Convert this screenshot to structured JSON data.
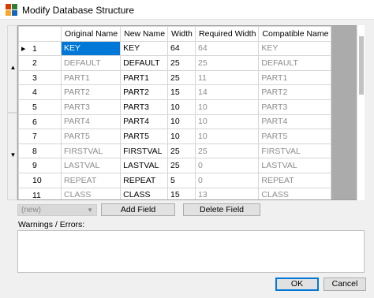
{
  "window": {
    "title": "Modify Database Structure"
  },
  "grid": {
    "columns": [
      "Original Name",
      "New Name",
      "Width",
      "Required Width",
      "Compatible Name"
    ],
    "rows": [
      {
        "num": "1",
        "original": "KEY",
        "new": "KEY",
        "width": "64",
        "required": "64",
        "compatible": "KEY"
      },
      {
        "num": "2",
        "original": "DEFAULT",
        "new": "DEFAULT",
        "width": "25",
        "required": "25",
        "compatible": "DEFAULT"
      },
      {
        "num": "3",
        "original": "PART1",
        "new": "PART1",
        "width": "25",
        "required": "11",
        "compatible": "PART1"
      },
      {
        "num": "4",
        "original": "PART2",
        "new": "PART2",
        "width": "15",
        "required": "14",
        "compatible": "PART2"
      },
      {
        "num": "5",
        "original": "PART3",
        "new": "PART3",
        "width": "10",
        "required": "10",
        "compatible": "PART3"
      },
      {
        "num": "6",
        "original": "PART4",
        "new": "PART4",
        "width": "10",
        "required": "10",
        "compatible": "PART4"
      },
      {
        "num": "7",
        "original": "PART5",
        "new": "PART5",
        "width": "10",
        "required": "10",
        "compatible": "PART5"
      },
      {
        "num": "8",
        "original": "FIRSTVAL",
        "new": "FIRSTVAL",
        "width": "25",
        "required": "25",
        "compatible": "FIRSTVAL"
      },
      {
        "num": "9",
        "original": "LASTVAL",
        "new": "LASTVAL",
        "width": "25",
        "required": "0",
        "compatible": "LASTVAL"
      },
      {
        "num": "10",
        "original": "REPEAT",
        "new": "REPEAT",
        "width": "5",
        "required": "0",
        "compatible": "REPEAT"
      },
      {
        "num": "11",
        "original": "CLASS",
        "new": "CLASS",
        "width": "15",
        "required": "13",
        "compatible": "CLASS"
      }
    ]
  },
  "controls": {
    "combo_value": "(new)",
    "add_field_label": "Add Field",
    "delete_field_label": "Delete Field",
    "warnings_label": "Warnings / Errors:",
    "ok_label": "OK",
    "cancel_label": "Cancel"
  },
  "icons": {
    "app": "app-grid-icon",
    "row_pointer": "row-pointer-icon",
    "scroll_up": "scroll-up-arrow-icon",
    "scroll_down": "scroll-down-arrow-icon",
    "combo_arrow": "chevron-down-icon"
  },
  "colors": {
    "selection": "#0078d7",
    "grid_background": "#ababab",
    "readonly_text": "#8c8c8c"
  }
}
